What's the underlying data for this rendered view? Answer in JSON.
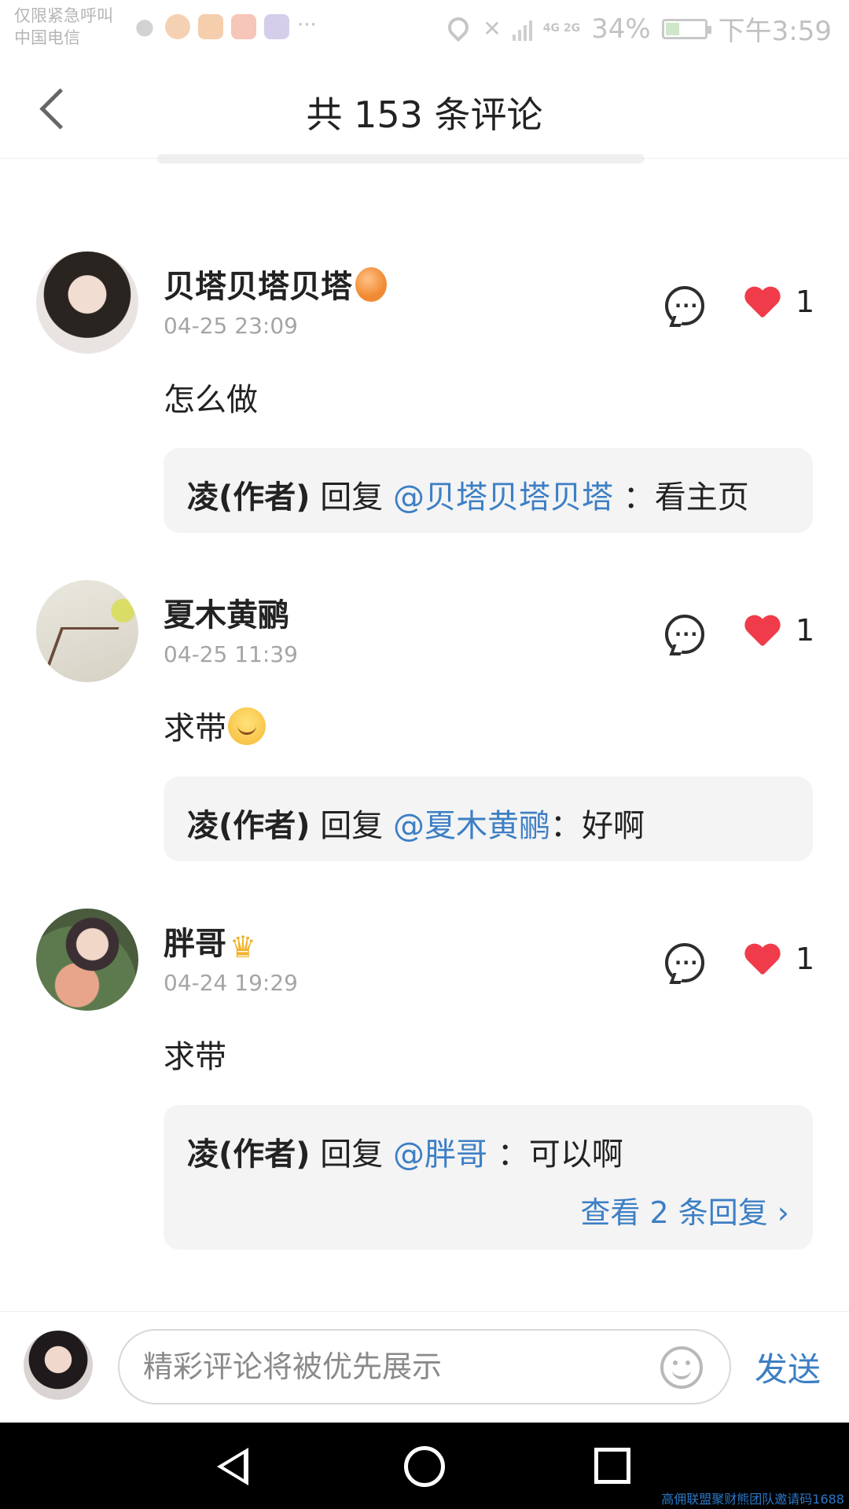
{
  "status_bar": {
    "carrier_line1": "仅限紧急呼叫",
    "carrier_line2": "中国电信",
    "battery": "34%",
    "time": "下午3:59",
    "network": "4G 2G",
    "icons": [
      "wechat-icon",
      "weibo-icon",
      "app-icon",
      "app-icon",
      "video-icon",
      "more-icon",
      "location-icon",
      "mute-icon",
      "signal-icon",
      "battery-icon"
    ]
  },
  "header": {
    "title": "共 153 条评论"
  },
  "comments": [
    {
      "username": "贝塔贝塔贝塔",
      "badge": "balloon",
      "date": "04-25 23:09",
      "likes": "1",
      "text": "怎么做",
      "reply": {
        "author": "凌(作者)",
        "verb": " 回复 ",
        "mention": "@贝塔贝塔贝塔",
        "content": "     ：看主页"
      }
    },
    {
      "username": "夏木黄鹂",
      "date": "04-25 11:39",
      "likes": "1",
      "text": "求带",
      "reply": {
        "author": "凌(作者)",
        "verb": " 回复 ",
        "mention": "@夏木黄鹂",
        "content": "：好啊"
      }
    },
    {
      "username": "胖哥",
      "badge": "crown",
      "date": "04-24 19:29",
      "likes": "1",
      "text": "求带",
      "reply": {
        "author": "凌(作者)",
        "verb": " 回复 ",
        "mention": "@胖哥",
        "content": "       ：可以啊",
        "more": "查看 2 条回复 ›"
      }
    }
  ],
  "input_bar": {
    "placeholder": "精彩评论将被优先展示",
    "send_label": "发送"
  },
  "watermark": "高佣联盟聚财熊团队邀请码1688",
  "colors": {
    "accent": "#3d7fc4",
    "like": "#f03c4a",
    "reply_bg": "#f4f4f5"
  }
}
